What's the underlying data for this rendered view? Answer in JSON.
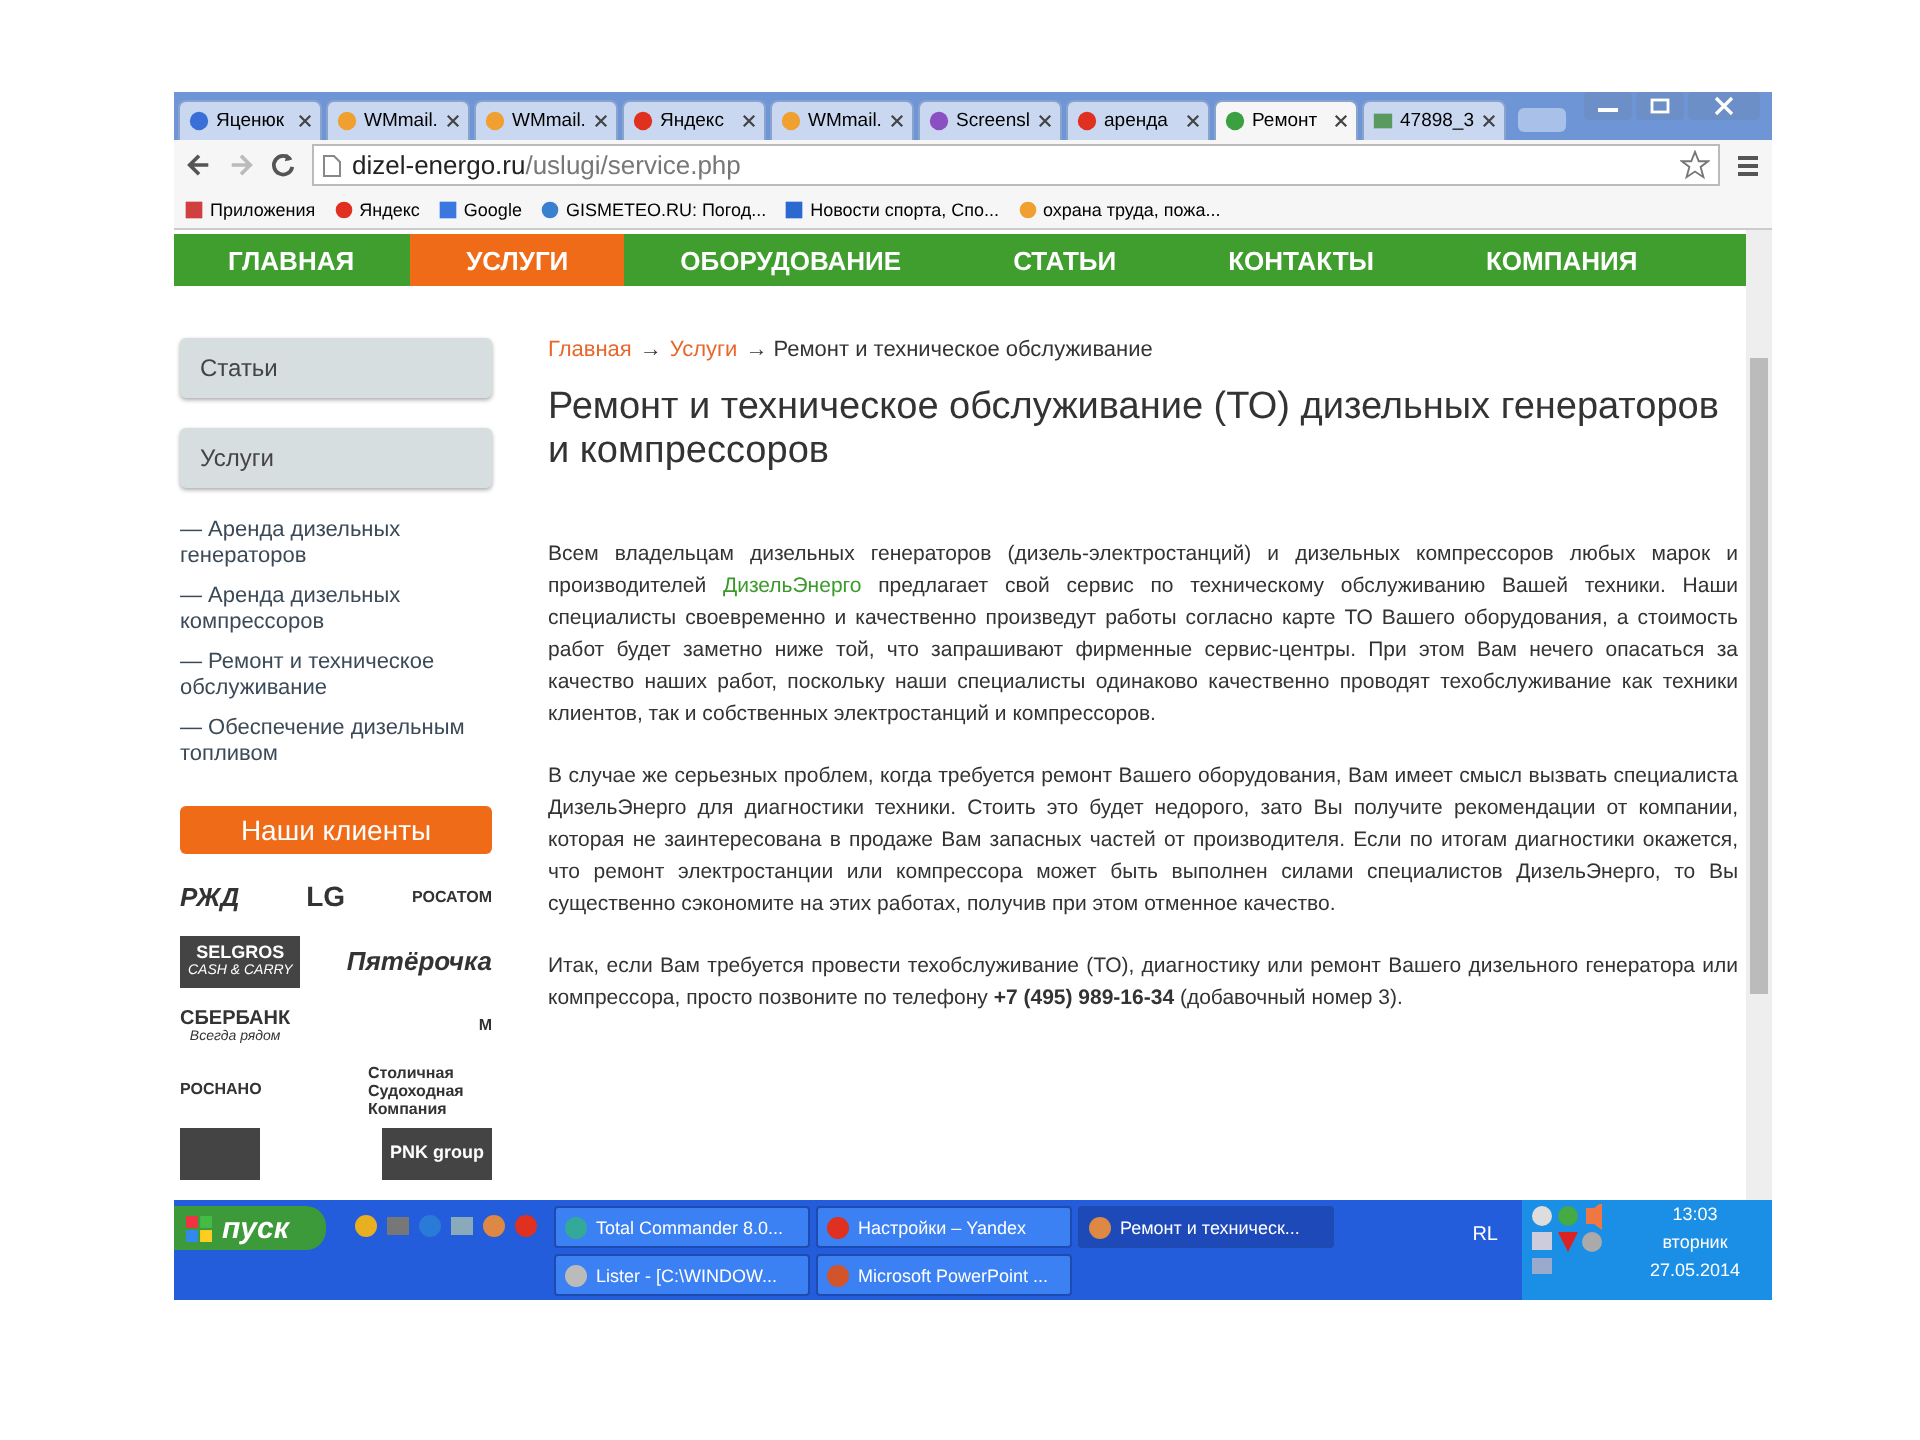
{
  "browser": {
    "tabs": [
      {
        "title": "Яценюк",
        "kind": "script",
        "selected": false
      },
      {
        "title": "WMmail.",
        "kind": "orange",
        "selected": false
      },
      {
        "title": "WMmail.",
        "kind": "orange",
        "selected": false
      },
      {
        "title": "Яндекс",
        "kind": "yandex",
        "selected": false
      },
      {
        "title": "WMmail.",
        "kind": "orange",
        "selected": false
      },
      {
        "title": "Screensl",
        "kind": "feather",
        "selected": false
      },
      {
        "title": "аренда",
        "kind": "yandex",
        "selected": false
      },
      {
        "title": "Ремонт",
        "kind": "leaf",
        "selected": true
      },
      {
        "title": "47898_3",
        "kind": "image",
        "selected": false
      }
    ],
    "url": {
      "host": "dizel-energo.ru",
      "path": "/uslugi/service.php"
    },
    "bookmarks": [
      {
        "title": "Приложения",
        "kind": "apps"
      },
      {
        "title": "Яндекс",
        "kind": "yandex"
      },
      {
        "title": "Google",
        "kind": "google"
      },
      {
        "title": "GISMETEO.RU: Погод...",
        "kind": "drop"
      },
      {
        "title": "Новости спорта, Спо...",
        "kind": "sport"
      },
      {
        "title": "охрана труда, пожа...",
        "kind": "orange"
      }
    ]
  },
  "site": {
    "nav": [
      {
        "label": "ГЛАВНАЯ",
        "selected": false
      },
      {
        "label": "УСЛУГИ",
        "selected": true
      },
      {
        "label": "ОБОРУДОВАНИЕ",
        "selected": false
      },
      {
        "label": "СТАТЬИ",
        "selected": false
      },
      {
        "label": "КОНТАКТЫ",
        "selected": false
      },
      {
        "label": "КОМПАНИЯ",
        "selected": false
      }
    ],
    "sidebar": {
      "panels": [
        "Статьи",
        "Услуги"
      ],
      "links": [
        "— Аренда дизельных генераторов",
        "— Аренда дизельных компрессоров",
        "— Ремонт и техническое обслуживание",
        "— Обеспечение дизельным топливом"
      ],
      "clients_title": "Наши клиенты",
      "clients": [
        [
          {
            "name": "РЖД",
            "kind": "italic"
          },
          {
            "name": "LG",
            "kind": "circle"
          },
          {
            "name": "РОСАТОМ",
            "kind": "emblem"
          }
        ],
        [
          {
            "name": "SELGROS",
            "sub": "CASH & CARRY",
            "kind": "block"
          },
          {
            "name": "Пятёрочка",
            "kind": "italic"
          }
        ],
        [
          {
            "name": "СБЕРБАНК",
            "sub": "Всегда рядом",
            "kind": "plain"
          },
          {
            "name": "М",
            "kind": "emblem"
          }
        ],
        [
          {
            "name": "РОСНАНО",
            "kind": "emblem"
          },
          {
            "name": "Столичная Судоходная Компания",
            "kind": "wrap"
          }
        ],
        [
          {
            "kind": "block"
          },
          {
            "name": "PNK group",
            "kind": "block"
          }
        ]
      ]
    },
    "breadcrumbs": [
      {
        "label": "Главная",
        "kind": "link"
      },
      {
        "label": "→",
        "kind": "sep"
      },
      {
        "label": "Услуги",
        "kind": "link"
      },
      {
        "label": "→ Ремонт и техническое обслуживание",
        "kind": "current"
      }
    ],
    "title": "Ремонт и техническое обслуживание (ТО) дизельных генераторов и компрессоров",
    "paragraphs": [
      [
        {
          "kind": "text",
          "text": "Всем владельцам дизельных генераторов (дизель-электростанций) и дизельных компрессоров любых марок и производителей "
        },
        {
          "kind": "link",
          "text": "ДизельЭнерго"
        },
        {
          "kind": "text",
          "text": " предлагает свой сервис по техническому обслуживанию Вашей техники. Наши специалисты своевременно и качественно произведут работы согласно карте ТО Вашего оборудования, а стоимость работ будет заметно ниже той, что запрашивают фирменные сервис-центры. При этом Вам нечего опасаться за качество наших работ, поскольку наши специалисты одинаково качественно проводят техобслуживание как техники клиентов, так и собственных электростанций и компрессоров."
        }
      ],
      [
        {
          "kind": "text",
          "text": "В случае же серьезных проблем, когда требуется ремонт Вашего оборудования, Вам имеет смысл вызвать специалиста ДизельЭнерго для диагностики техники. Стоить это будет недорого, зато Вы получите рекомендации от компании, которая не заинтересована в продаже Вам запасных частей от производителя. Если по итогам диагностики окажется, что ремонт электростанции или компрессора может быть выполнен силами специалистов ДизельЭнерго, то Вы существенно сэкономите на этих работах, получив при этом отменное качество."
        }
      ],
      [
        {
          "kind": "text",
          "text": "Итак, если Вам требуется провести техобслуживание (ТО), диагностику или ремонт Вашего дизельного генератора или компрессора, просто позвоните по телефону **+7 (495) 989-16-34** (добавочный номер 3)."
        }
      ]
    ]
  },
  "taskbar": {
    "start": "пуск",
    "quick_launch": [
      {
        "kind": "aim"
      },
      {
        "kind": "film"
      },
      {
        "kind": "ie"
      },
      {
        "kind": "monitor"
      },
      {
        "kind": "chrome"
      },
      {
        "kind": "yandex"
      }
    ],
    "tasks": [
      {
        "title": "Total Commander 8.0...",
        "kind": "tc",
        "selected": false
      },
      {
        "title": "Настройки – Yandex",
        "kind": "yandex",
        "selected": false
      },
      {
        "title": "Ремонт и техническ...",
        "kind": "chrome",
        "selected": true
      },
      {
        "title": "Lister - [C:\\WINDOW...",
        "kind": "doc",
        "selected": false
      },
      {
        "title": "Microsoft PowerPoint ...",
        "kind": "ppt",
        "selected": false
      }
    ],
    "lang": "RL",
    "time": "13:03",
    "weekday": "вторник",
    "date": "27.05.2014"
  }
}
